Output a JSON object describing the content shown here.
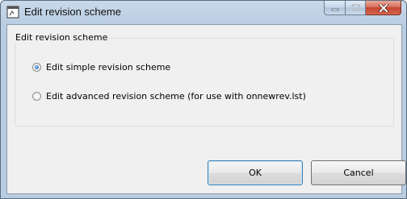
{
  "window": {
    "title": "Edit revision scheme",
    "icon": "app-icon"
  },
  "group": {
    "label": "Edit revision scheme",
    "options": [
      {
        "label": "Edit simple revision scheme",
        "checked": true
      },
      {
        "label": "Edit advanced revision scheme (for use with onnewrev.lst)",
        "checked": false
      }
    ]
  },
  "buttons": {
    "ok": "OK",
    "cancel": "Cancel"
  },
  "colors": {
    "title_bar": "#b9cde2",
    "client": "#f0f0f0",
    "close_button": "#c44530"
  }
}
